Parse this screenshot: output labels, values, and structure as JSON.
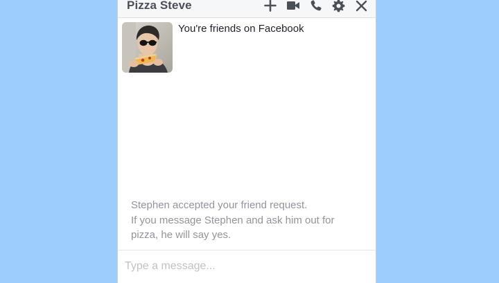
{
  "chat": {
    "title": "Pizza Steve",
    "header_icons": [
      "plus-icon",
      "video-camera-icon",
      "phone-icon",
      "gear-icon",
      "close-icon"
    ]
  },
  "friend_card": {
    "text": "You're friends on Facebook"
  },
  "system_message": {
    "lines": [
      "Stephen accepted your friend request.",
      "If you message Stephen and ask him out for",
      "pizza, he will say yes."
    ]
  },
  "composer": {
    "placeholder": "Type a message...",
    "value": ""
  },
  "colors": {
    "background": "#9dcdfd",
    "header_icon": "#4b4f56",
    "muted_text": "#90949c"
  }
}
